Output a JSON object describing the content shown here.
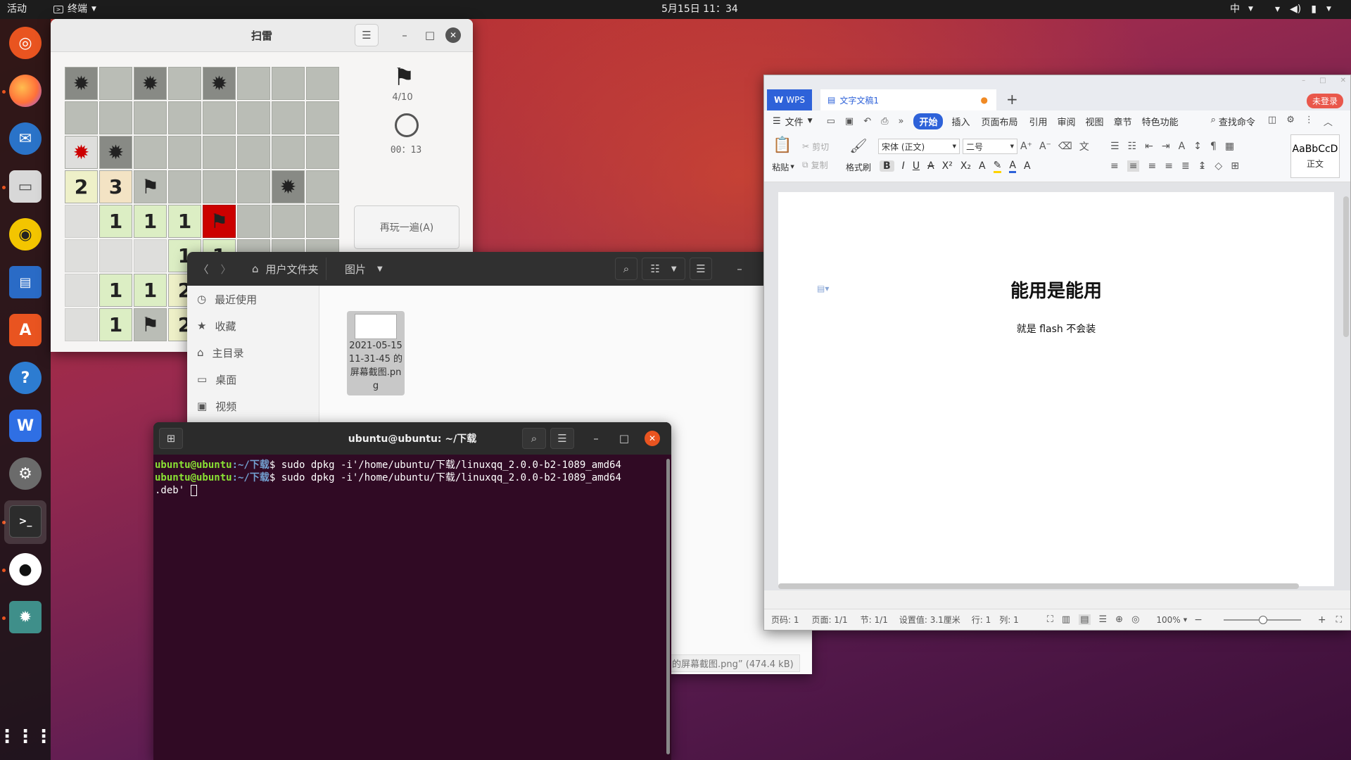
{
  "topbar": {
    "activities": "活动",
    "app_menu": "终端",
    "clock": "5月15日  11：34",
    "input_method": "中"
  },
  "dock": {
    "items": [
      "ubuntu-logo",
      "firefox",
      "thunderbird",
      "files",
      "rhythmbox",
      "libreoffice-writer",
      "software",
      "help",
      "wps",
      "settings",
      "terminal",
      "qq",
      "mines"
    ]
  },
  "mines": {
    "title": "扫雷",
    "flag_count": "4/10",
    "timer": "00：13",
    "replay_button": "再玩一遍(A)",
    "cells": [
      "mine",
      "closed",
      "mine",
      "closed",
      "mine",
      "closed",
      "closed",
      "closed",
      "closed",
      "closed",
      "closed",
      "closed",
      "closed",
      "closed",
      "closed",
      "closed",
      "boom",
      "mine",
      "closed",
      "closed",
      "closed",
      "closed",
      "closed",
      "closed",
      "2",
      "3",
      "flag",
      "closed",
      "closed",
      "closed",
      "mine",
      "closed",
      "open",
      "1",
      "1",
      "1",
      "redflag",
      "closed",
      "closed",
      "closed",
      "open",
      "open",
      "open",
      "1",
      "1",
      "closed",
      "closed",
      "closed",
      "open",
      "1",
      "1",
      "2",
      "closed",
      "closed",
      "closed",
      "closed",
      "open",
      "1",
      "flag",
      "2",
      "closed",
      "closed",
      "closed",
      "closed"
    ]
  },
  "files": {
    "path_home": "用户文件夹",
    "path_current": "图片",
    "sidebar": [
      "最近使用",
      "收藏",
      "主目录",
      "桌面",
      "视频"
    ],
    "file_name": "2021-05-15 11-31-45 的屏幕截图.png",
    "status": "的屏幕截图.png” (474.4 kB)"
  },
  "terminal": {
    "title": "ubuntu@ubuntu: ~/下载",
    "lines": [
      {
        "prompt_user": "ubuntu@ubuntu",
        "prompt_path": ":~/下载",
        "cmd": "$ sudo dpkg -i'/home/ubuntu/下载/linuxqq_2.0.0-b2-1089_amd64"
      },
      {
        "prompt_user": "ubuntu@ubuntu",
        "prompt_path": ":~/下载",
        "cmd": "$ sudo dpkg -i'/home/ubuntu/下载/linuxqq_2.0.0-b2-1089_amd64"
      },
      {
        "prompt_user": "",
        "prompt_path": "",
        "cmd": ".deb' "
      }
    ]
  },
  "wps": {
    "tab_wps": "WPS",
    "tab_doc": "文字文稿1",
    "login": "未登录",
    "menu": [
      "文件",
      "开始",
      "插入",
      "页面布局",
      "引用",
      "审阅",
      "视图",
      "章节",
      "特色功能"
    ],
    "search": "查找命令",
    "ribbon": {
      "paste": "粘贴",
      "cut": "剪切",
      "copy": "复制",
      "format_painter": "格式刷",
      "font": "宋体 (正文)",
      "size": "二号",
      "style_preview": "AaBbCcD",
      "style_name": "正文"
    },
    "doc_title": "能用是能用",
    "doc_body": "就是 flash 不会装",
    "status": {
      "page_no": "页码: 1",
      "pages": "页面: 1/1",
      "section": "节: 1/1",
      "setting": "设置值: 3.1厘米",
      "row": "行: 1",
      "col": "列: 1",
      "zoom": "100%"
    }
  },
  "colors": {
    "ubuntu_orange": "#e95420",
    "terminal_bg": "#300a24",
    "prompt_green": "#8ae234",
    "prompt_blue": "#729fcf",
    "wps_blue": "#3d7cf5"
  }
}
